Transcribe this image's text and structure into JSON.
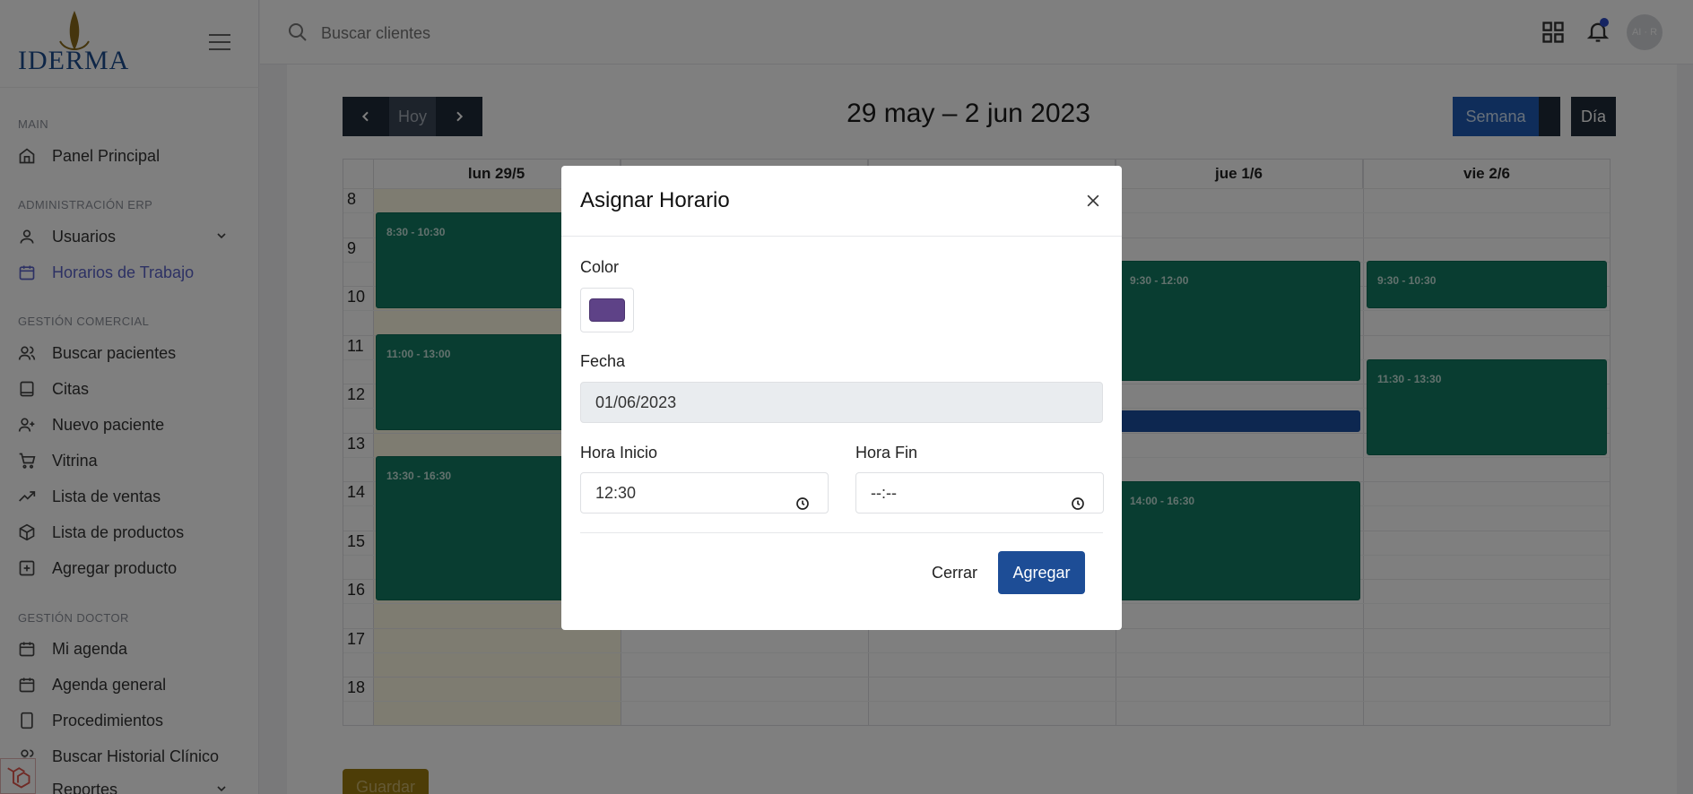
{
  "brand": {
    "logo_text": "IDERMA"
  },
  "search": {
    "placeholder": "Buscar clientes"
  },
  "user": {
    "initials": "AI · R"
  },
  "sidebar": {
    "sections": [
      {
        "title": "MAIN"
      },
      {
        "title": "ADMINISTRACIÓN ERP"
      },
      {
        "title": "GESTIÓN COMERCIAL"
      },
      {
        "title": "GESTIÓN DOCTOR"
      }
    ],
    "items": [
      {
        "label": "Panel Principal",
        "icon": "home-icon"
      },
      {
        "label": "Usuarios",
        "icon": "user-icon"
      },
      {
        "label": "Horarios de Trabajo",
        "icon": "calendar-icon",
        "active": true
      },
      {
        "label": "Buscar pacientes",
        "icon": "users-icon"
      },
      {
        "label": "Citas",
        "icon": "book-icon"
      },
      {
        "label": "Nuevo paciente",
        "icon": "user-plus-icon"
      },
      {
        "label": "Vitrina",
        "icon": "cart-icon"
      },
      {
        "label": "Lista de ventas",
        "icon": "trending-up-icon"
      },
      {
        "label": "Lista de productos",
        "icon": "box-icon"
      },
      {
        "label": "Agregar producto",
        "icon": "plus-square-icon"
      },
      {
        "label": "Mi agenda",
        "icon": "calendar-icon"
      },
      {
        "label": "Agenda general",
        "icon": "calendar-icon"
      },
      {
        "label": "Procedimientos",
        "icon": "tablet-icon"
      },
      {
        "label": "Buscar Historial Clínico",
        "icon": "users-icon"
      },
      {
        "label": "Reportes",
        "icon": "chart-icon"
      }
    ]
  },
  "calendar": {
    "title": "29 may – 2 jun 2023",
    "today_label": "Hoy",
    "view_week": "Semana",
    "view_day": "Día",
    "days": [
      "lun 29/5",
      "",
      "",
      "jue 1/6",
      "vie 2/6"
    ],
    "hours": [
      "8",
      "9",
      "10",
      "11",
      "12",
      "13",
      "14",
      "15",
      "16",
      "17",
      "18"
    ],
    "events": [
      {
        "day": 0,
        "label": "8:30 - 10:30"
      },
      {
        "day": 0,
        "label": "11:00 - 13:00"
      },
      {
        "day": 0,
        "label": "13:30 - 16:30"
      },
      {
        "day": 3,
        "label": "9:30 - 12:00"
      },
      {
        "day": 3,
        "label": "14:00 - 16:30"
      },
      {
        "day": 4,
        "label": "9:30 - 10:30"
      },
      {
        "day": 4,
        "label": "11:30 - 13:30"
      }
    ],
    "save_label": "Guardar"
  },
  "modal": {
    "title": "Asignar Horario",
    "color_label": "Color",
    "color_value": "#5e4287",
    "date_label": "Fecha",
    "date_value": "01/06/2023",
    "start_label": "Hora Inicio",
    "start_value": "12:30",
    "end_label": "Hora Fin",
    "end_value": "--:--",
    "close_label": "Cerrar",
    "add_label": "Agregar"
  },
  "colors": {
    "primary": "#1d4d96",
    "event_green": "#127b62",
    "accent": "#5a63c8"
  }
}
